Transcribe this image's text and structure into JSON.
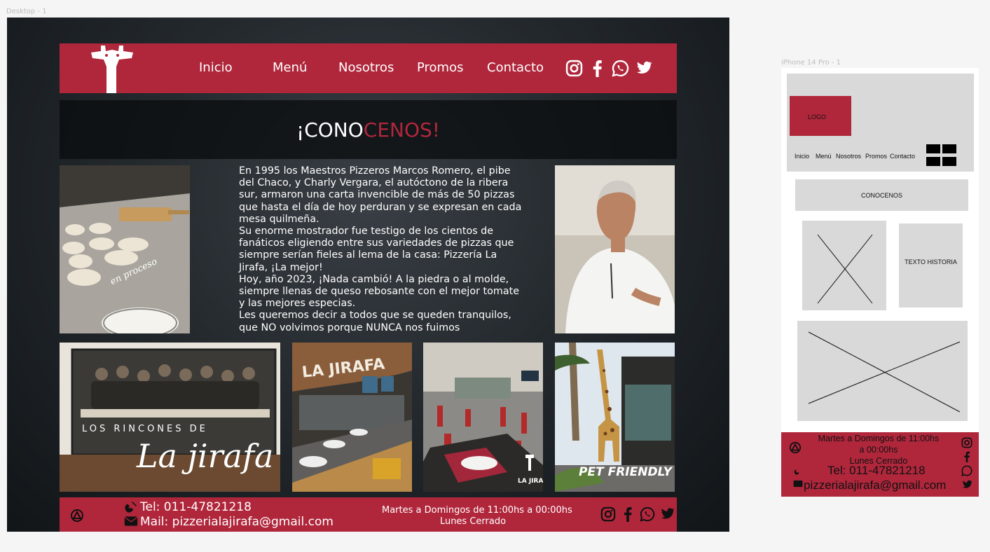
{
  "canvas": {
    "desktop_label": "Desktop - 1",
    "mobile_label": "iPhone 14 Pro - 1"
  },
  "colors": {
    "brand_red": "#b0273c",
    "wireframe_gray": "#d9d9d9"
  },
  "desktop": {
    "nav": {
      "logo_icon": "giraffe-logo",
      "links": [
        "Inicio",
        "Menú",
        "Nosotros",
        "Promos",
        "Contacto"
      ],
      "social_icons": [
        "instagram-icon",
        "facebook-icon",
        "whatsapp-icon",
        "twitter-icon"
      ]
    },
    "hero": {
      "title_prefix": "¡CONO",
      "title_accent": "CENOS!"
    },
    "photos": {
      "dough": {
        "caption": "en proceso"
      },
      "murals": {
        "line1": "LOS RINCONES DE",
        "line2": "La jirafa"
      },
      "counter": {
        "sign": "LA JIRAFA"
      },
      "dining": {
        "stamp": "LA JIRAFA"
      },
      "giraffe_statue": {
        "caption": "PET FRIENDLY"
      }
    },
    "story": {
      "paragraphs": [
        "En 1995 los Maestros Pizzeros Marcos Romero, el pibe del Chaco, y Charly Vergara, el autóctono de la ribera sur, armaron una carta invencible de más de 50 pizzas que hasta el día de hoy perduran y se expresan en cada mesa quilmeña.",
        "Su enorme mostrador fue testigo de los cientos de fanáticos eligiendo entre sus variedades de pizzas que siempre serían fieles al lema de la casa: Pizzería La Jirafa, ¡La mejor!",
        "Hoy, año 2023, ¡Nada cambió! A la piedra o al molde, siempre llenas de queso rebosante con el mejor tomate y las mejores especias.",
        "Les queremos decir a todos que se queden tranquilos, que NO volvimos porque NUNCA nos fuimos"
      ]
    },
    "footer": {
      "tel": "Tel: 011-47821218",
      "mail": "Mail: pizzerialajirafa@gmail.com",
      "hours_line1": "Martes a Domingos de 11:00hs a 00:00hs",
      "hours_line2": "Lunes Cerrado"
    }
  },
  "mobile": {
    "logo_label": "LOGO",
    "nav_links": [
      "Inicio",
      "Menú",
      "Nosotros",
      "Promos",
      "Contacto"
    ],
    "section_title": "CONOCENOS",
    "history_label": "TEXTO HISTORIA",
    "footer": {
      "hours_line1": "Martes a Domingos de 11:00hs",
      "hours_line2": "a 00:00hs",
      "hours_line3": "Lunes Cerrado",
      "tel": "Tel: 011-47821218",
      "mail": "pizzerialajirafa@gmail.com"
    }
  }
}
